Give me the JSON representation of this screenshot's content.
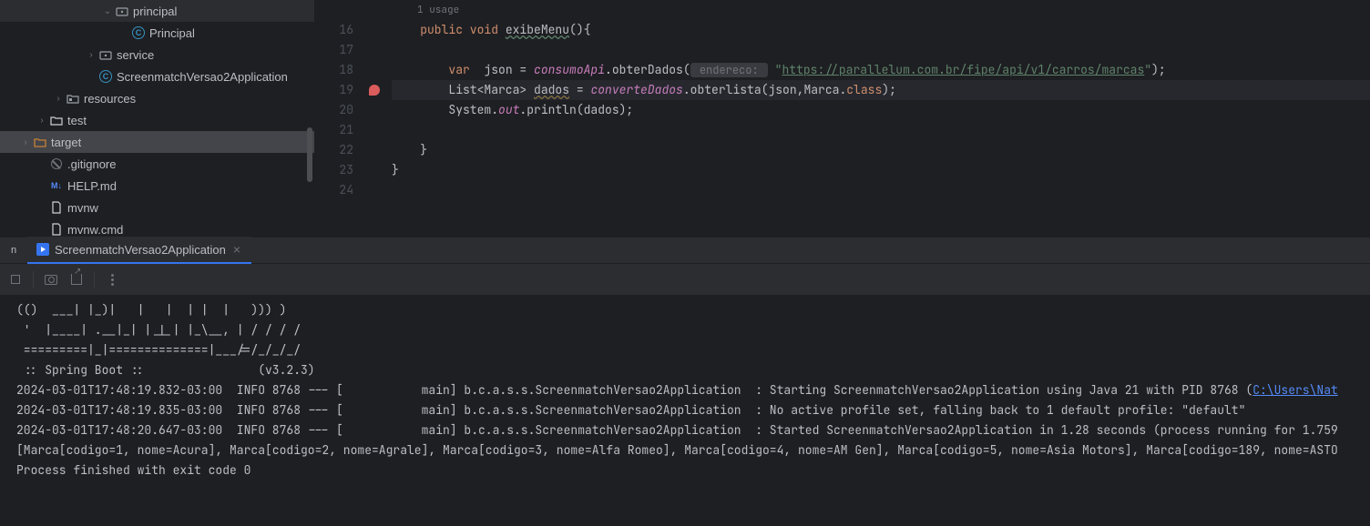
{
  "tree": {
    "items": [
      {
        "depth": 5,
        "arrow": "down",
        "icon": "pkg",
        "label": "principal"
      },
      {
        "depth": 6,
        "arrow": "",
        "icon": "class",
        "label": "Principal"
      },
      {
        "depth": 4,
        "arrow": "right",
        "icon": "pkg",
        "label": "service"
      },
      {
        "depth": 4,
        "arrow": "",
        "icon": "class",
        "label": "ScreenmatchVersao2Application"
      },
      {
        "depth": 2,
        "arrow": "right",
        "icon": "res",
        "label": "resources"
      },
      {
        "depth": 1,
        "arrow": "right",
        "icon": "folder",
        "label": "test"
      },
      {
        "depth": 0,
        "arrow": "right",
        "icon": "folder-orange",
        "label": "target",
        "sel": true
      },
      {
        "depth": 1,
        "arrow": "",
        "icon": "git",
        "label": ".gitignore"
      },
      {
        "depth": 1,
        "arrow": "",
        "icon": "md",
        "label": "HELP.md"
      },
      {
        "depth": 1,
        "arrow": "",
        "icon": "txt",
        "label": "mvnw"
      },
      {
        "depth": 1,
        "arrow": "",
        "icon": "txt",
        "label": "mvnw.cmd"
      }
    ]
  },
  "editor": {
    "usage": "1 usage",
    "line_start": 16,
    "lines": [
      {
        "n": 16,
        "seg": [
          {
            "t": "    ",
            "c": ""
          },
          {
            "t": "public void ",
            "c": "kw"
          },
          {
            "t": "exibeMenu",
            "c": "mname"
          },
          {
            "t": "(){",
            "c": ""
          }
        ]
      },
      {
        "n": 17,
        "seg": [
          {
            "t": "",
            "c": ""
          }
        ]
      },
      {
        "n": 18,
        "seg": [
          {
            "t": "        ",
            "c": ""
          },
          {
            "t": "var  ",
            "c": "kw"
          },
          {
            "t": "json = ",
            "c": ""
          },
          {
            "t": "consumoApi",
            "c": "field"
          },
          {
            "t": ".obterDados(",
            "c": ""
          },
          {
            "t": " endereco: ",
            "c": "hint-box"
          },
          {
            "t": " ",
            "c": ""
          },
          {
            "t": "\"",
            "c": "str"
          },
          {
            "t": "https://parallelum.com.br/fipe/api/v1/carros/marcas",
            "c": "url-str"
          },
          {
            "t": "\"",
            "c": "str"
          },
          {
            "t": ");",
            "c": ""
          }
        ]
      },
      {
        "n": 19,
        "hl": true,
        "mark": "bulb",
        "seg": [
          {
            "t": "        List<Marca> ",
            "c": ""
          },
          {
            "t": "dados",
            "c": "warn-name"
          },
          {
            "t": " = ",
            "c": ""
          },
          {
            "t": "converteDados",
            "c": "field"
          },
          {
            "t": ".obterlista(json,Marca.",
            "c": ""
          },
          {
            "t": "class",
            "c": "kw"
          },
          {
            "t": ");",
            "c": ""
          }
        ]
      },
      {
        "n": 20,
        "seg": [
          {
            "t": "        System.",
            "c": ""
          },
          {
            "t": "out",
            "c": "staticf"
          },
          {
            "t": ".println(dados);",
            "c": ""
          }
        ]
      },
      {
        "n": 21,
        "seg": [
          {
            "t": "",
            "c": ""
          }
        ]
      },
      {
        "n": 22,
        "seg": [
          {
            "t": "    }",
            "c": ""
          }
        ]
      },
      {
        "n": 23,
        "seg": [
          {
            "t": "}",
            "c": ""
          }
        ]
      },
      {
        "n": 24,
        "seg": [
          {
            "t": "",
            "c": ""
          }
        ]
      }
    ]
  },
  "run": {
    "tab_label": "ScreenmatchVersao2Application",
    "left_stub": "n",
    "console_lines": [
      {
        "t": "(()  ___| |_)|   |   |  | |  |   ))) )"
      },
      {
        "t": " '  |____| .__|_| |_|_| |_\\__, | / / / /"
      },
      {
        "t": " =========|_|==============|___/=/_/_/_/"
      },
      {
        "t": " :: Spring Boot ::                (v3.2.3)"
      },
      {
        "t": ""
      },
      {
        "pre": "2024-03-01T17:48:19.832-03:00  INFO 8768 --- [           main] b.c.a.s.s.ScreenmatchVersao2Application  : Starting ScreenmatchVersao2Application using Java 21 with PID 8768 (",
        "link": "C:\\Users\\Nat"
      },
      {
        "t": "2024-03-01T17:48:19.835-03:00  INFO 8768 --- [           main] b.c.a.s.s.ScreenmatchVersao2Application  : No active profile set, falling back to 1 default profile: \"default\""
      },
      {
        "t": "2024-03-01T17:48:20.647-03:00  INFO 8768 --- [           main] b.c.a.s.s.ScreenmatchVersao2Application  : Started ScreenmatchVersao2Application in 1.28 seconds (process running for 1.759"
      },
      {
        "t": "[Marca[codigo=1, nome=Acura], Marca[codigo=2, nome=Agrale], Marca[codigo=3, nome=Alfa Romeo], Marca[codigo=4, nome=AM Gen], Marca[codigo=5, nome=Asia Motors], Marca[codigo=189, nome=ASTO"
      },
      {
        "t": ""
      },
      {
        "t": "Process finished with exit code 0"
      }
    ]
  }
}
